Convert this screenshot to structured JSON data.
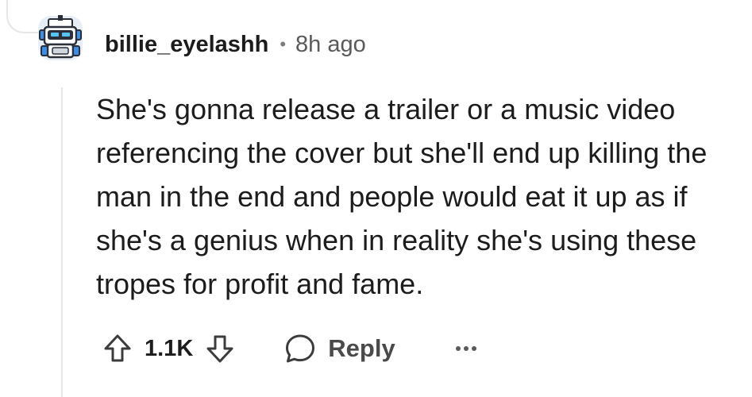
{
  "comment": {
    "username": "billie_eyelashh",
    "separator": "•",
    "timestamp": "8h ago",
    "text": "She's gonna release a trailer or a music video referencing the cover but she'll end up killing the man in the end and people would eat it up as if she's a genius when in reality she's using these tropes for profit and fame.",
    "avatar_icon": "robot-avatar-icon"
  },
  "actions": {
    "vote_count": "1.1K",
    "reply_label": "Reply",
    "upvote_icon": "upvote-arrow-icon",
    "downvote_icon": "downvote-arrow-icon",
    "reply_icon": "speech-bubble-icon",
    "more_icon": "more-options-icon"
  },
  "colors": {
    "text": "#1c1c1c",
    "muted": "#5a5a5a",
    "thread_line": "#e6e6e6",
    "avatar_bg": "#3b8de6"
  }
}
